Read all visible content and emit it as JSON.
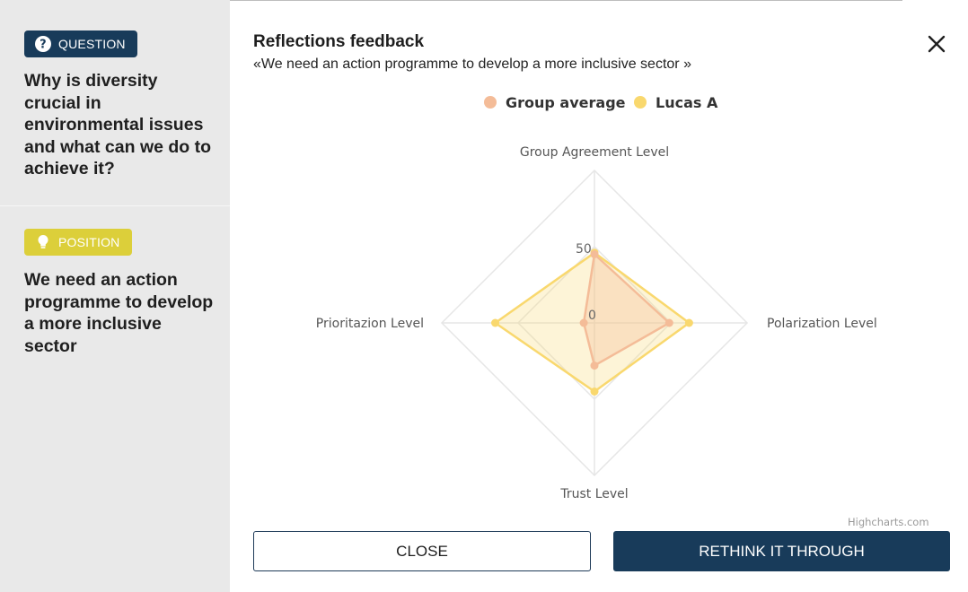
{
  "sidebar": {
    "question_badge": "QUESTION",
    "question_text": "Why is diversity crucial in environmental issues and what can we do to achieve it?",
    "position_badge": "POSITION",
    "position_text": "We need an action programme to develop a more inclusive sector"
  },
  "dialog": {
    "title": "Reflections feedback",
    "subtitle": "«We need an action programme to develop a more inclusive sector »",
    "close_icon": "close-icon",
    "credit": "Highcharts.com",
    "close_button": "CLOSE",
    "rethink_button": "RETHINK IT THROUGH"
  },
  "colors": {
    "navy": "#183b5a",
    "position_yellow": "#dccf3a",
    "group_series": "#f4bc98",
    "user_series": "#f9d86e"
  },
  "chart_data": {
    "type": "radar",
    "categories": [
      "Group Agreement Level",
      "Polarization Level",
      "Trust Level",
      "Prioritazion Level"
    ],
    "ytick_labels": [
      "0",
      "50"
    ],
    "ylim": [
      0,
      100
    ],
    "legend_placement": "top-center",
    "series": [
      {
        "name": "Group average",
        "values": [
          45,
          49,
          28,
          7
        ],
        "color": "#f4bc98"
      },
      {
        "name": "Lucas A",
        "values": [
          46,
          62,
          45,
          65
        ],
        "color": "#f9d86e"
      }
    ]
  }
}
